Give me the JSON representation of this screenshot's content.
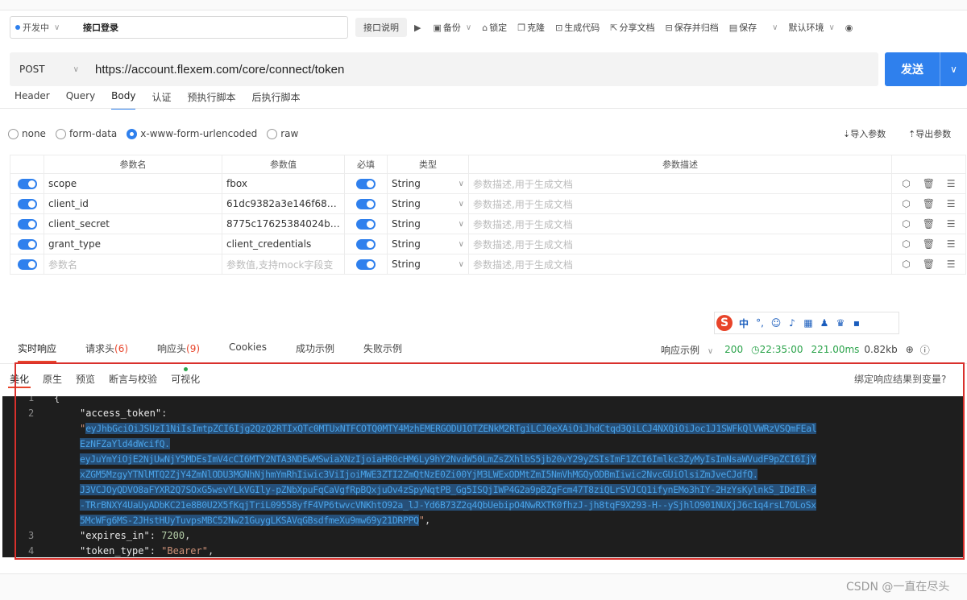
{
  "toolbar": {
    "status": "开发中",
    "api_name": "接口登录",
    "desc_btn": "接口说明",
    "backup": "备份",
    "lock": "锁定",
    "clone": "克隆",
    "gen_code": "生成代码",
    "share_doc": "分享文档",
    "save_archive": "保存并归档",
    "save": "保存",
    "env": "默认环境"
  },
  "request": {
    "method": "POST",
    "url": "https://account.flexem.com/core/connect/token",
    "send": "发送",
    "tabs": [
      "Header",
      "Query",
      "Body",
      "认证",
      "预执行脚本",
      "后执行脚本"
    ],
    "active_tab": "Body"
  },
  "body": {
    "types": [
      "none",
      "form-data",
      "x-www-form-urlencoded",
      "raw"
    ],
    "selected": "x-www-form-urlencoded",
    "import_params": "导入参数",
    "export_params": "导出参数"
  },
  "params": {
    "headers": [
      "参数名",
      "参数值",
      "必填",
      "类型",
      "参数描述"
    ],
    "rows": [
      {
        "name": "scope",
        "value": "fbox",
        "type": "String",
        "desc": "参数描述,用于生成文档"
      },
      {
        "name": "client_id",
        "value": "61dc9382a3e146f68fce",
        "type": "String",
        "desc": "参数描述,用于生成文档"
      },
      {
        "name": "client_secret",
        "value": "8775c17625384024b4b",
        "type": "String",
        "desc": "参数描述,用于生成文档"
      },
      {
        "name": "grant_type",
        "value": "client_credentials",
        "type": "String",
        "desc": "参数描述,用于生成文档"
      }
    ],
    "new_row": {
      "name_ph": "参数名",
      "value_ph": "参数值,支持mock字段变",
      "type": "String",
      "desc": "参数描述,用于生成文档"
    }
  },
  "ime": {
    "s": "S",
    "zh": "中"
  },
  "response": {
    "tabs": [
      {
        "label": "实时响应",
        "count": ""
      },
      {
        "label": "请求头",
        "count": "(6)"
      },
      {
        "label": "响应头",
        "count": "(9)"
      },
      {
        "label": "Cookies",
        "count": ""
      },
      {
        "label": "成功示例",
        "count": ""
      },
      {
        "label": "失败示例",
        "count": ""
      }
    ],
    "example": "响应示例",
    "status": "200",
    "time": "22:35:00",
    "duration": "221.00ms",
    "size": "0.82kb",
    "view_tabs": [
      "美化",
      "原生",
      "预览",
      "断言与校验",
      "可视化"
    ],
    "bind": "绑定响应结果到变量?",
    "lines": {
      "l1": "{",
      "key_access": "\"access_token\"",
      "token1": "eyJhbGciOiJSUzI1NiIsImtpZCI6Ijg2QzQ2RTIxQTc0MTUxNTFCOTQ0MTY4MzhEMERGODU1OTZENkM2RTgiLCJ0eXAiOiJhdCtqd3QiLCJ4NXQiOiJoc1J1SWFkQlVWRzVSQmFEal",
      "token2": "EzNFZaYld4dWcifQ.",
      "token3": "eyJuYmYiOjE2NjUwNjY5MDEsImV4cCI6MTY2NTA3NDEwMSwiaXNzIjoiaHR0cHM6Ly9hY2NvdW50LmZsZXhlbS5jb20vY29yZSIsImF1ZCI6Imlkc3ZyMyIsImNsaWVudF9pZCI6IjY",
      "token4": "xZGM5MzgyYTNlMTQ2ZjY4ZmNlODU3MGNhNjhmYmRhIiwic3ViIjoiMWE3ZTI2ZmQtNzE0Zi00YjM3LWExODMtZmI5NmVhMGQyODBmIiwic2NvcGUiOlsiZmJveCJdfQ.",
      "token5": "J3VCJOyQDVO8aFYXR2Q7SOxG5wsvYLkVGIly-pZNbXpuFqCaVgfRpBQxjuOv4zSpyNqtPB_Gg5ISQjIWP4G2a9pBZgFcm47T8ziQLrSVJCQ1ifynEMo3hIY-2HzYsKylnkS_IDdIR-d",
      "token6": "-TRrBNXY4UaUyADbKC21e8B0U2X5fKqjTriL09558yfF4VP6twvcVNKhtO92a_lJ-Yd6B73Z2q4QbUebipO4NwRXTK0fhzJ-jh8tqF9X293-H--ySjhlO901NUXjJ6c1q4rsL7OLoSx",
      "token7": "5McWFg6MS-2JHstHUyTuvpsMBC52Nw21GuygLKSAVqGBsdfmeXu9mw69y21DRPPQ",
      "key_expires": "\"expires_in\"",
      "expires": "7200",
      "key_type": "\"token_type\"",
      "type": "\"Bearer\""
    }
  },
  "watermark": "CSDN @一直在尽头",
  "colors": {
    "accent": "#2f80ed",
    "error_red": "#e8442a",
    "ok_green": "#2aa34a",
    "editor_bg": "#1e1e1e"
  }
}
